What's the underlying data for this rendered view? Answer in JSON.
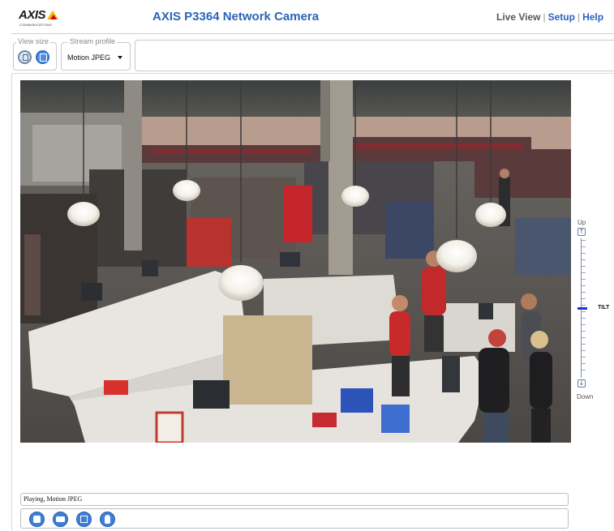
{
  "header": {
    "logo_text": "AXIS",
    "logo_subtext": "COMMUNICATIONS",
    "title": "AXIS P3364 Network Camera",
    "nav": {
      "live_view": "Live View",
      "separator": "|",
      "setup": "Setup",
      "help": "Help"
    }
  },
  "toolbar": {
    "view_size_label": "View size",
    "view_size_icons": [
      "view-size-half-icon",
      "view-size-full-icon"
    ],
    "stream_profile_label": "Stream profile",
    "stream_profile_value": "Motion JPEG"
  },
  "video": {
    "description_icon": "live-camera-feed"
  },
  "tilt": {
    "up_label": "Up",
    "down_label": "Down",
    "label": "TILT",
    "up_icon": "↑",
    "down_icon": "↓",
    "position_fraction": 0.5
  },
  "status": {
    "text": "Playing, Motion JPEG"
  },
  "controls": {
    "buttons": [
      {
        "name": "stop",
        "icon": "stop-icon"
      },
      {
        "name": "snapshot",
        "icon": "camera-icon"
      },
      {
        "name": "fullscreen",
        "icon": "fullscreen-icon"
      },
      {
        "name": "audio",
        "icon": "microphone-icon"
      }
    ]
  },
  "colors": {
    "brand_blue": "#2b64b8",
    "logo_yellow": "#f2b800",
    "logo_red": "#d3001b",
    "button_blue": "#3d7fd9",
    "tilt_handle": "#1f2fd8"
  }
}
